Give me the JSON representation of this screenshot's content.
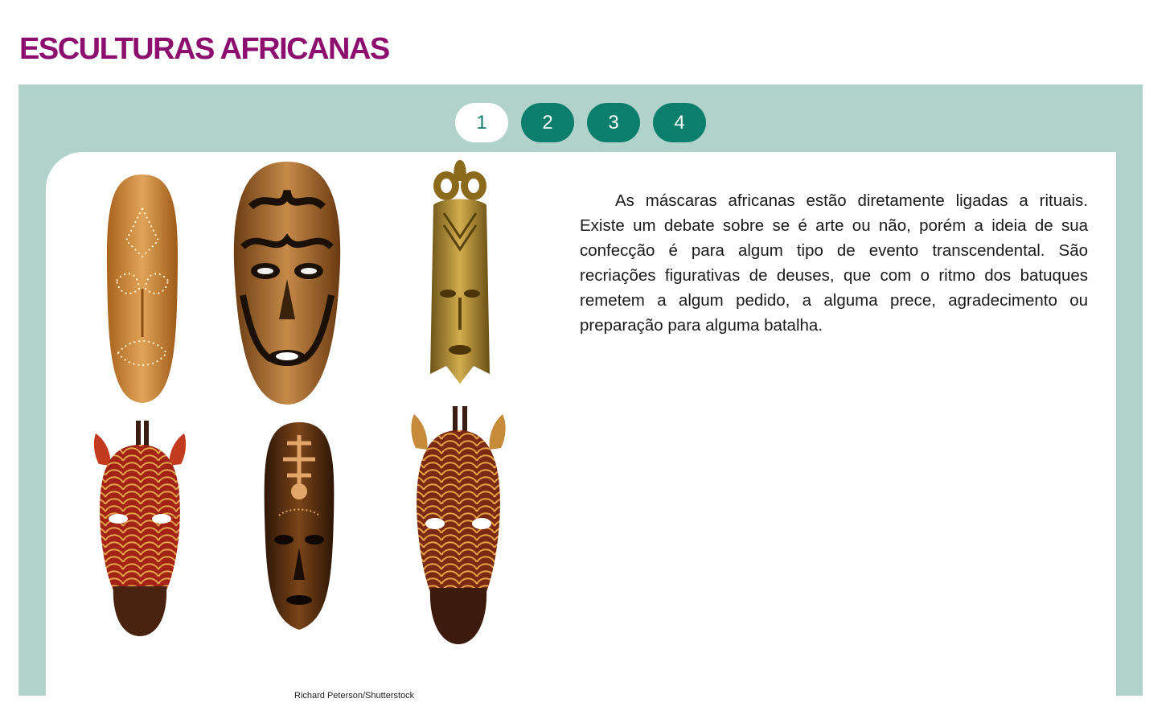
{
  "page": {
    "title": "ESCULTURAS AFRICANAS"
  },
  "pager": {
    "items": [
      "1",
      "2",
      "3",
      "4"
    ],
    "active": "1"
  },
  "content": {
    "paragraph": "As máscaras africanas estão diretamente ligadas a rituais. Existe um debate sobre se é arte ou não, porém a ideia de sua confecção é para algum tipo de evento transcendental. São recriações figurativas de deuses, que com o ritmo dos batuques remetem a algum pedido, a alguma prece, agradecimento ou preparação para alguma batalha.",
    "image_credit": "Richard Peterson/Shutterstock"
  },
  "colors": {
    "title": "#8c0f6f",
    "panel": "#b1d2ca",
    "pill": "#0c7e6c",
    "pill_active_bg": "#ffffff"
  }
}
